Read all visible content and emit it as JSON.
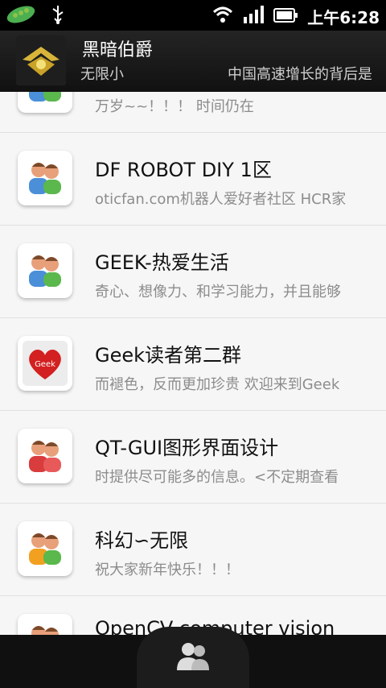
{
  "status_bar": {
    "time": "上午6:28",
    "icons": [
      "leaf-icon",
      "usb-icon",
      "wifi-icon",
      "signal-icon",
      "battery-icon"
    ]
  },
  "header": {
    "title": "黑暗伯爵",
    "subtitle_left": "无限小",
    "subtitle_right": "中国高速增长的背后是"
  },
  "groups": [
    {
      "name": "",
      "desc": "万岁~~！！！ 时间仍在",
      "thumb": "people-icon-blue"
    },
    {
      "name": "DF ROBOT DIY 1区",
      "desc": "oticfan.com机器人爱好者社区 HCR家",
      "thumb": "people-icon-blue"
    },
    {
      "name": "GEEK-热爱生活",
      "desc": "奇心、想像力、和学习能力，并且能够",
      "thumb": "people-icon-blue"
    },
    {
      "name": "Geek读者第二群",
      "desc": "而褪色，反而更加珍贵 欢迎来到Geek",
      "thumb": "geek-heart-icon"
    },
    {
      "name": "QT-GUI图形界面设计",
      "desc": "时提供尽可能多的信息。<不定期查看",
      "thumb": "people-icon-red"
    },
    {
      "name": "科幻∽无限",
      "desc": "祝大家新年快乐！！！",
      "thumb": "people-icon-orange"
    },
    {
      "name": "OpenCV computer vision",
      "desc": "",
      "thumb": "people-icon-red"
    }
  ],
  "bottom": {
    "tab_icon": "contacts-icon"
  }
}
